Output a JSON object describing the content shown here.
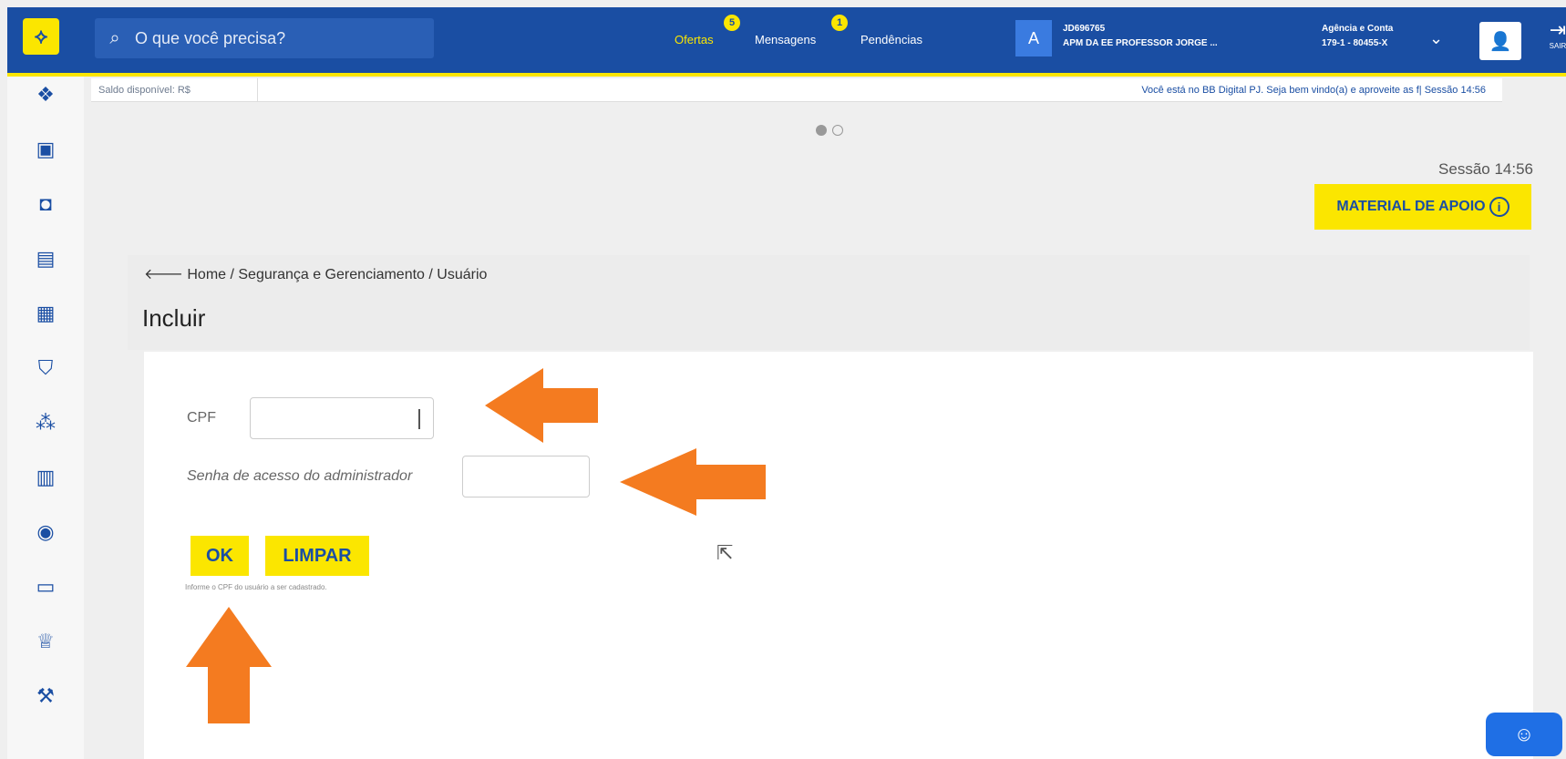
{
  "header": {
    "search_placeholder": "O que você precisa?",
    "nav": {
      "ofertas": "Ofertas",
      "ofertas_badge": "5",
      "mensagens": "Mensagens",
      "mensagens_badge": "1",
      "pendencias": "Pendências"
    },
    "account_initial": "A",
    "account_code": "JD696765",
    "account_name": "APM DA EE PROFESSOR JORGE ...",
    "agency_label": "Agência e Conta",
    "agency_value": "179-1 - 80455-X",
    "exit_label": "SAIR"
  },
  "infobar": {
    "balance": "Saldo disponível: R$",
    "welcome": "Você está no BB Digital PJ. Seja bem vindo(a) e aproveite as f|  Sessão 14:56"
  },
  "session": "Sessão 14:56",
  "material_button": "MATERIAL DE APOIO",
  "breadcrumb": "Home / Segurança e Gerenciamento / Usuário",
  "page_title": "Incluir",
  "form": {
    "cpf_label": "CPF",
    "cpf_value": "",
    "password_label": "Senha de acesso do administrador",
    "password_value": "",
    "ok_label": "OK",
    "clear_label": "LIMPAR",
    "hint": "Informe o CPF do usuário a ser cadastrado."
  },
  "colors": {
    "brand_blue": "#1a4ea3",
    "brand_yellow": "#fbe600",
    "annotation_orange": "#f47b20"
  },
  "icons": {
    "sidebar": [
      "home-icon",
      "cash-icon",
      "wallet-icon",
      "document-check-icon",
      "receipt-icon",
      "shield-icon",
      "people-icon",
      "barcode-icon",
      "loan-icon",
      "card-icon",
      "trophy-icon",
      "auction-icon"
    ]
  }
}
